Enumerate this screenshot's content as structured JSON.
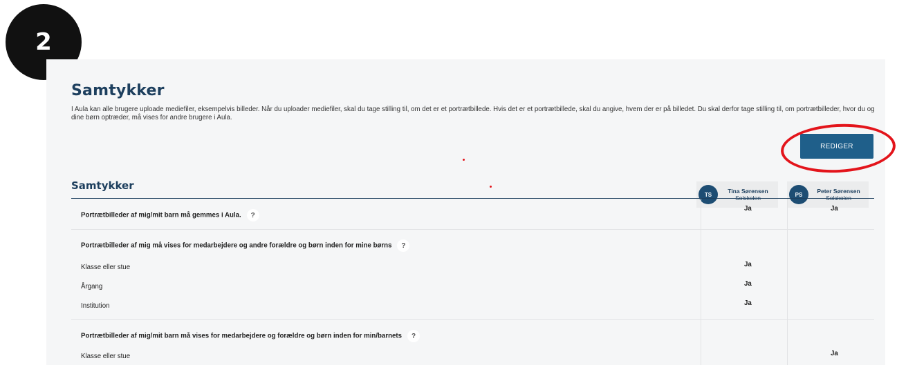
{
  "step_badge": "2",
  "page": {
    "title": "Samtykker",
    "intro": "I Aula kan alle brugere uploade mediefiler, eksempelvis billeder. Når du uploader mediefiler, skal du tage stilling til, om det er et portrætbillede. Hvis det er et portrætbillede, skal du angive, hvem der er på billedet. Du skal derfor tage stilling til, om portrætbilleder, hvor du og dine børn optræder, må vises for andre brugere i Aula.",
    "edit_button": "REDIGER",
    "section_heading": "Samtykker"
  },
  "people": [
    {
      "initials": "TS",
      "name": "Tina Sørensen",
      "school": "Solskolen"
    },
    {
      "initials": "PS",
      "name": "Peter Sørensen",
      "school": "Solskolen"
    }
  ],
  "rows": [
    {
      "label": "Portrætbilleder af mig/mit barn må gemmes i Aula.",
      "help": "?",
      "values": [
        "Ja",
        "Ja"
      ]
    },
    {
      "label": "Portrætbilleder af mig må vises for medarbejdere og andre forældre og børn inden for mine børns",
      "help": "?"
    },
    {
      "label": "Klasse eller stue",
      "values": [
        "Ja",
        ""
      ]
    },
    {
      "label": "Årgang",
      "values": [
        "Ja",
        ""
      ]
    },
    {
      "label": "Institution",
      "values": [
        "Ja",
        ""
      ]
    },
    {
      "label": "Portrætbilleder af mig/mit barn må vises for medarbejdere og forældre og børn inden for min/barnets",
      "help": "?"
    },
    {
      "label": "Klasse eller stue",
      "values": [
        "",
        "Ja"
      ]
    }
  ],
  "colors": {
    "accent": "#1d3f5e",
    "button": "#1f5f8a",
    "highlight": "#e3141b",
    "badge": "#111111"
  }
}
